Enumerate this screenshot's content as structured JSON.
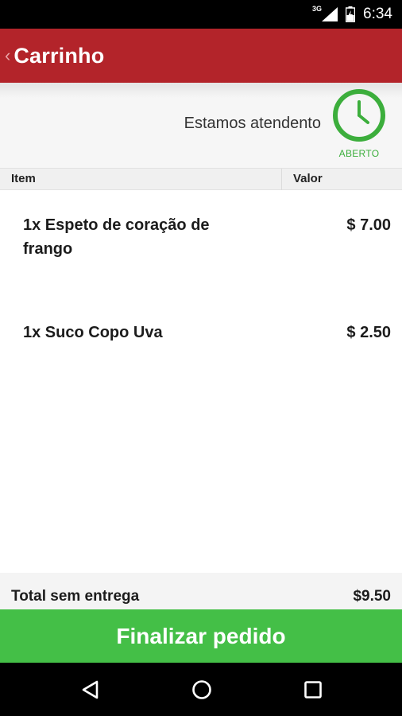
{
  "status_bar": {
    "network": "3G",
    "time": "6:34"
  },
  "app_bar": {
    "back_icon": "chevron-left-icon",
    "title": "Carrinho",
    "color": "#b3242a"
  },
  "store_status": {
    "message": "Estamos atendento",
    "badge": "ABERTO",
    "icon": "clock-icon",
    "color": "#3cae3c"
  },
  "table": {
    "headers": [
      "Item",
      "Valor"
    ],
    "items": [
      {
        "name": "1x Espeto de coração de frango",
        "price": "$ 7.00"
      },
      {
        "name": "1x Suco Copo Uva",
        "price": "$ 2.50"
      }
    ]
  },
  "total": {
    "label": "Total sem entrega",
    "value": "$9.50"
  },
  "checkout": {
    "label": "Finalizar pedido",
    "color": "#44bf47"
  },
  "nav_bar": {
    "icons": [
      "back-triangle-icon",
      "home-circle-icon",
      "recents-square-icon"
    ]
  }
}
